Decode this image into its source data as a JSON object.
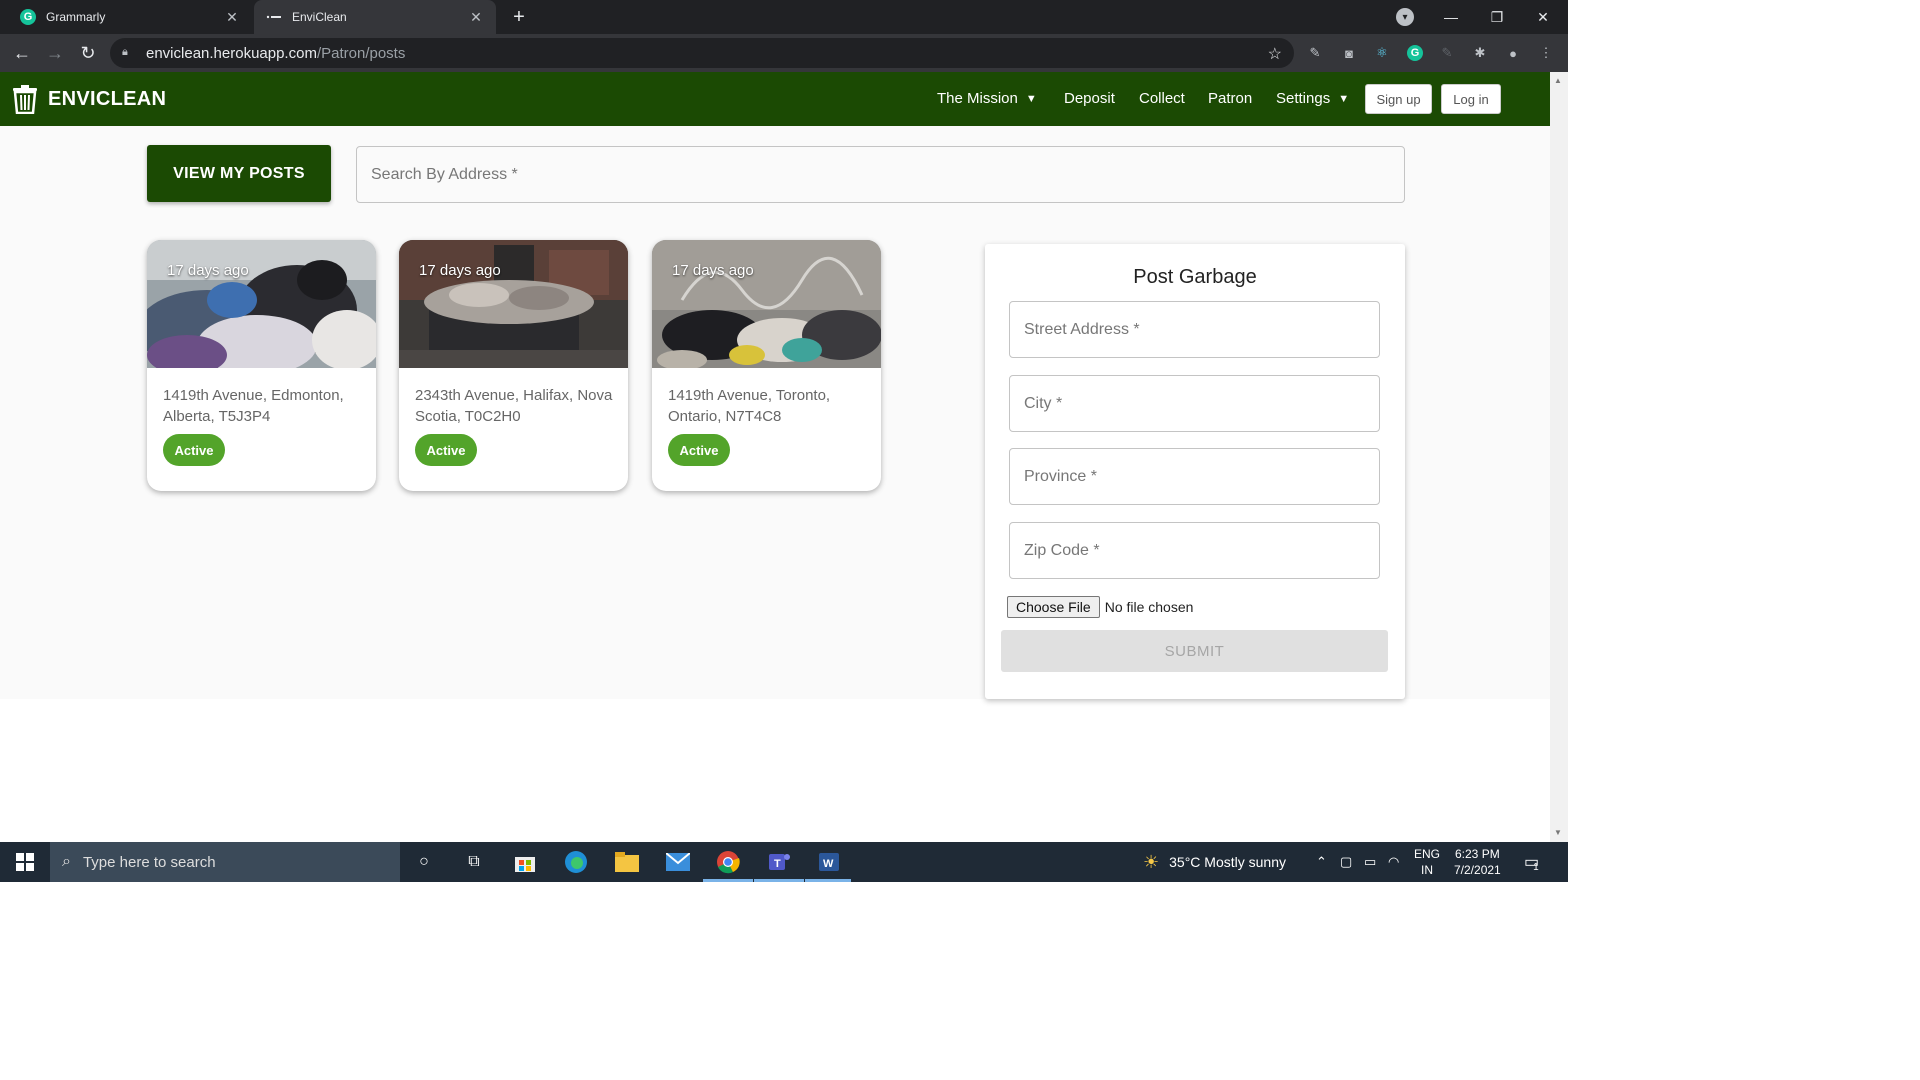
{
  "browser": {
    "tabs": [
      {
        "title": "Grammarly",
        "favicon": "grammarly-icon",
        "active": false
      },
      {
        "title": "EnviClean",
        "favicon": "enviclean-icon",
        "active": true
      }
    ],
    "url_host": "enviclean.herokuapp.com",
    "url_path": "/Patron/posts"
  },
  "app": {
    "brand": "ENVICLEAN",
    "nav": {
      "mission": "The Mission",
      "deposit": "Deposit",
      "collect": "Collect",
      "patron": "Patron",
      "settings": "Settings",
      "signup": "Sign up",
      "login": "Log in"
    },
    "colors": {
      "primary": "#1b4a03",
      "active_badge": "#53a42a"
    }
  },
  "toolbar": {
    "view_posts": "VIEW MY POSTS",
    "search_placeholder": "Search By Address *"
  },
  "posts": [
    {
      "time": "17 days ago",
      "address": "1419th Avenue, Edmonton, Alberta, T5J3P4",
      "status": "Active"
    },
    {
      "time": "17 days ago",
      "address": "2343th Avenue, Halifax, Nova Scotia, T0C2H0",
      "status": "Active"
    },
    {
      "time": "17 days ago",
      "address": "1419th Avenue, Toronto, Ontario, N7T4C8",
      "status": "Active"
    }
  ],
  "form": {
    "title": "Post Garbage",
    "street": "Street Address *",
    "city": "City *",
    "province": "Province *",
    "zip": "Zip Code *",
    "choose_file": "Choose File",
    "no_file": "No file chosen",
    "submit": "SUBMIT"
  },
  "taskbar": {
    "search_placeholder": "Type here to search",
    "weather": "35°C  Mostly sunny",
    "lang_top": "ENG",
    "lang_bottom": "IN",
    "time": "6:23 PM",
    "date": "7/2/2021",
    "notif_count": "1"
  }
}
